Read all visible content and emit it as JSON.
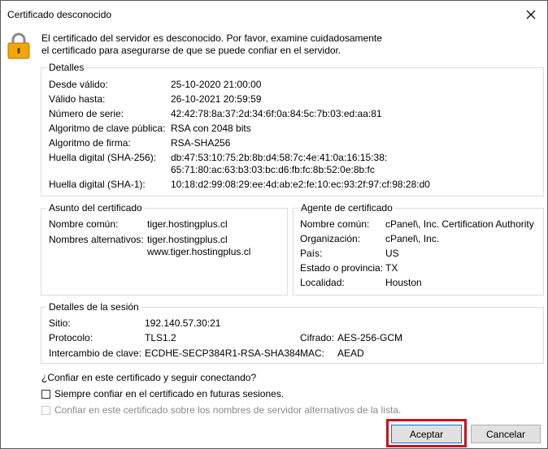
{
  "window": {
    "title": "Certificado desconocido"
  },
  "message": {
    "line1": "El certificado del servidor es desconocido. Por favor, examine cuidadosamente",
    "line2": "el certificado para asegurarse de que se puede confiar en el servidor."
  },
  "details": {
    "legend": "Detalles",
    "rows": [
      {
        "label": "Desde válido:",
        "value": "25-10-2020 21:00:00"
      },
      {
        "label": "Válido hasta:",
        "value": "26-10-2021 20:59:59"
      },
      {
        "label": "Número de serie:",
        "value": "42:42:78:8a:37:2d:34:6f:0a:84:5c:7b:03:ed:aa:81"
      },
      {
        "label": "Algoritmo de clave pública:",
        "value": "RSA con 2048 bits"
      },
      {
        "label": "Algoritmo de firma:",
        "value": "RSA-SHA256"
      },
      {
        "label": "Huella digital (SHA-256):",
        "value": "db:47:53:10:75:2b:8b:d4:58:7c:4e:41:0a:16:15:38:\n65:71:80:ac:63:b3:03:bc:d6:fb:fc:8b:52:0e:8b:fc"
      },
      {
        "label": "Huella digital (SHA-1):",
        "value": "10:18:d2:99:08:29:ee:4d:ab:e2:fe:10:ec:93:2f:97:cf:98:28:d0"
      }
    ]
  },
  "subject": {
    "legend": "Asunto del certificado",
    "rows": [
      {
        "label": "Nombre común:",
        "value": "tiger.hostingplus.cl"
      },
      {
        "label": "Nombres alternativos:",
        "value": "tiger.hostingplus.cl\nwww.tiger.hostingplus.cl"
      }
    ]
  },
  "issuer": {
    "legend": "Agente de certificado",
    "rows": [
      {
        "label": "Nombre común:",
        "value": "cPanel\\, Inc. Certification Authority"
      },
      {
        "label": "Organización:",
        "value": "cPanel\\, Inc."
      },
      {
        "label": "País:",
        "value": "US"
      },
      {
        "label": "Estado o provincia:",
        "value": "TX"
      },
      {
        "label": "Localidad:",
        "value": "Houston"
      }
    ]
  },
  "session": {
    "legend": "Detalles de la sesión",
    "host_label": "Sitio:",
    "host_value": "192.140.57.30:21",
    "protocol_label": "Protocolo:",
    "protocol_value": "TLS1.2",
    "cipher_label": "Cifrado:",
    "cipher_value": "AES-256-GCM",
    "kex_label": "Intercambio de clave:",
    "kex_value": "ECDHE-SECP384R1-RSA-SHA384",
    "mac_label": "MAC:",
    "mac_value": "AEAD"
  },
  "question": "¿Confiar en este certificado y seguir conectando?",
  "options": {
    "always_trust": "Siempre confiar en el certificado en futuras sesiones.",
    "trust_alt_names": "Confiar en este certificado sobre los nombres de servidor alternativos de la lista."
  },
  "buttons": {
    "accept": "Aceptar",
    "cancel": "Cancelar"
  },
  "colors": {
    "highlight": "#c8101e",
    "focus": "#0078d7",
    "lock_body": "#f0a70a"
  }
}
